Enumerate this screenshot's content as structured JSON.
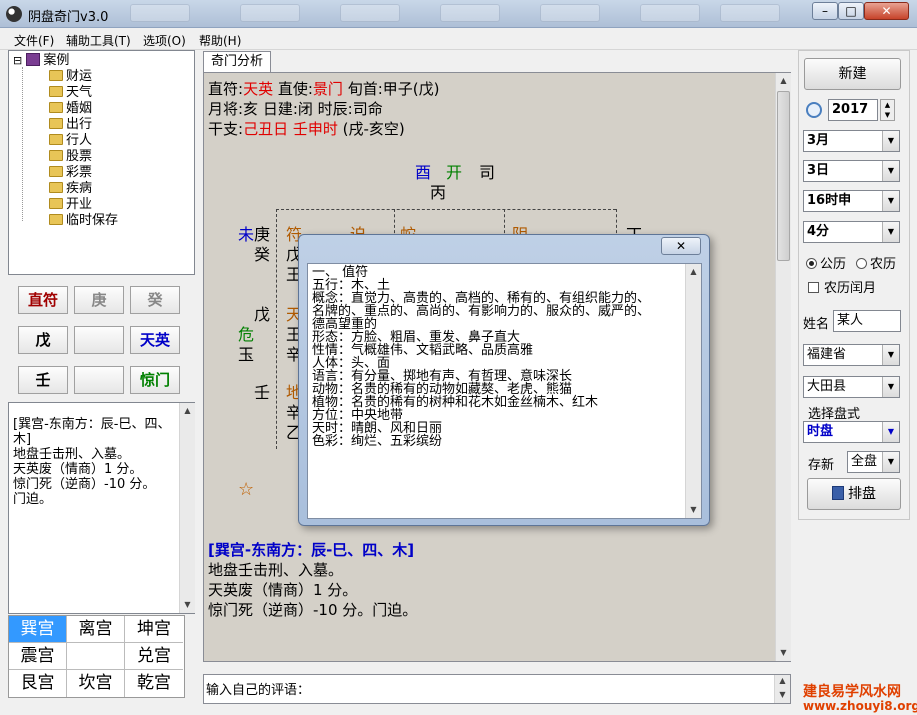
{
  "window": {
    "title": "阴盘奇门v3.0",
    "minimize": "–",
    "maximize": "□",
    "close": "✕"
  },
  "menu": [
    "文件(F)",
    "辅助工具(T)",
    "选项(O)",
    "帮助(H)"
  ],
  "tree": {
    "root": "案例",
    "expander": "⊟",
    "items": [
      "财运",
      "天气",
      "婚姻",
      "出行",
      "行人",
      "股票",
      "彩票",
      "疾病",
      "开业",
      "临时保存"
    ]
  },
  "grid_buttons": [
    [
      "直符",
      "庚",
      "癸"
    ],
    [
      "戊",
      "",
      "天英"
    ],
    [
      "壬",
      "",
      "惊门"
    ]
  ],
  "note": {
    "heading": "[巽宫-东南方：辰-巳、四、木]",
    "lines": [
      "地盘壬击刑、入墓。",
      "天英废（情商）1 分。",
      "惊门死（逆商）-10 分。",
      "门迫。"
    ]
  },
  "palaces": [
    [
      "巽宫",
      "离宫",
      "坤宫"
    ],
    [
      "震宫",
      "",
      "兑宫"
    ],
    [
      "艮宫",
      "坎宫",
      "乾宫"
    ]
  ],
  "tab": "奇门分析",
  "analysis": {
    "line1": {
      "a": "直符:",
      "b": "天英",
      "c": " 直使:",
      "d": "景门",
      "e": " 旬首:甲子(戊)"
    },
    "line2": "月将:亥 日建:闭 时辰:司命",
    "line3": {
      "a": "干支:",
      "b": "己丑日 壬申时",
      "c": " (戌-亥空)"
    },
    "chart": {
      "top_a": "酉",
      "top_b": "开",
      "top_c": "司",
      "top_d": "丙",
      "left1_a": "未",
      "left1_b": "庚",
      "left1_c": "癸",
      "left2_a": "戊",
      "left2_b": "危",
      "left2_c": "玉",
      "left3": "壬",
      "star": "☆",
      "c1": "符",
      "c2": "迫",
      "c3": "蛇",
      "c4": "阴",
      "c5": "丁",
      "r1": "戊",
      "r2": "王",
      "r3": "天",
      "r4": "王",
      "r5": "辛",
      "r6": "地",
      "r7": "辛",
      "r8": "乙"
    },
    "heading": "[巽宫-东南方：辰-巳、四、木]",
    "lines": [
      "地盘壬击刑、入墓。",
      "天英废（情商）1 分。",
      "惊门死（逆商）-10 分。门迫。"
    ]
  },
  "comment": {
    "label": "输入自己的评语："
  },
  "dialog": {
    "close": "✕",
    "lines": [
      "一、  值符",
      "五行：木、土",
      "概念：直觉力、高贵的、高档的、稀有的、有组织能力的、",
      "名牌的、重点的、高尚的、有影响力的、服众的、威严的、",
      "德高望重的",
      "形态：方脸、粗眉、重发、鼻子直大",
      "性情：气概雄伟、文韬武略、品质高雅",
      "人体：头、面",
      "语言：有分量、掷地有声、有哲理、意味深长",
      "动物：名贵的稀有的动物如藏獒、老虎、熊猫",
      "植物：名贵的稀有的树种和花木如金丝楠木、红木",
      "方位：中央地带",
      "天时：晴朗、风和日丽",
      "色彩：绚烂、五彩缤纷"
    ]
  },
  "right": {
    "new_button": "新建",
    "year": "2017",
    "month": "3月",
    "day": "3日",
    "hour": "16时申",
    "minute": "4分",
    "cal_solar": "公历",
    "cal_lunar": "农历",
    "leap": "农历闰月",
    "name_label": "姓名",
    "name_value": "某人",
    "province": "福建省",
    "county": "大田县",
    "style_label": "选择盘式",
    "style_value": "时盘",
    "save_label": "存新",
    "save_value": "全盘",
    "arrange_button": "排盘"
  },
  "watermark": {
    "line1": "建良易学风水网",
    "line2": "www.zhouyi8.org"
  }
}
